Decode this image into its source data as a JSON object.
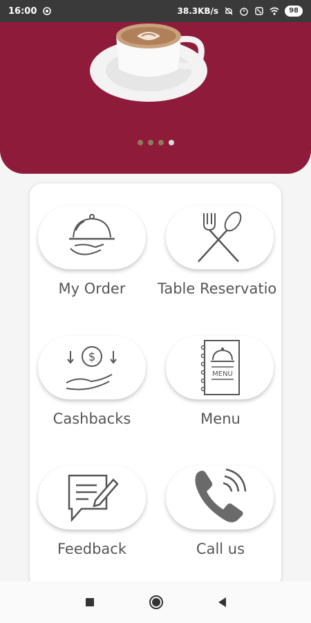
{
  "status_bar": {
    "time": "16:00",
    "net_speed": "38.3KB/s",
    "battery": "98"
  },
  "hero": {
    "image": "coffee-cup-latte-art",
    "background_color": "#8e1b3a",
    "carousel_dots": 4,
    "active_dot": 3
  },
  "menu_grid": {
    "items": [
      {
        "label": "My Order",
        "icon": "serving-tray-icon"
      },
      {
        "label": "Table Reservatio",
        "icon": "fork-spoon-icon"
      },
      {
        "label": "Cashbacks",
        "icon": "cashback-hand-icon"
      },
      {
        "label": "Menu",
        "icon": "menu-book-icon"
      },
      {
        "label": "Feedback",
        "icon": "feedback-chat-icon"
      },
      {
        "label": "Call us",
        "icon": "phone-icon"
      }
    ]
  }
}
